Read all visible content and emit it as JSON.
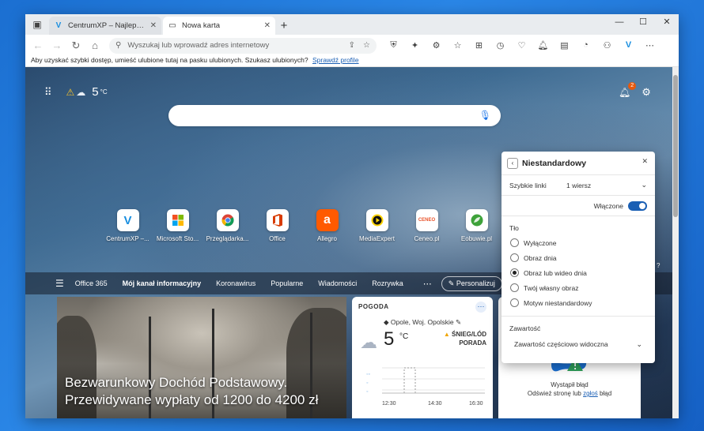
{
  "browser": {
    "tabs": [
      {
        "title": "CentrumXP – Najlepsze źródło o",
        "active": false
      },
      {
        "title": "Nowa karta",
        "active": true
      }
    ],
    "address": {
      "placeholder": "Wyszukaj lub wprowadź adres internetowy"
    },
    "favbar": {
      "text": "Aby uzyskać szybki dostęp, umieść ulubione tutaj na pasku ulubionych. Szukasz ulubionych?",
      "link": "Sprawdź profile"
    }
  },
  "newtab": {
    "weather_temp": "5",
    "weather_unit": "°C",
    "notification_count": "2",
    "tiles": [
      {
        "label": "CentrumXP –...",
        "icon": "centrumxp-logo-icon"
      },
      {
        "label": "Microsoft Sto...",
        "icon": "microsoft-store-icon"
      },
      {
        "label": "Przeglądarka...",
        "icon": "chrome-icon"
      },
      {
        "label": "Office",
        "icon": "office-icon"
      },
      {
        "label": "Allegro",
        "icon": "allegro-icon"
      },
      {
        "label": "MediaExpert",
        "icon": "mediaexpert-icon"
      },
      {
        "label": "Ceneo.pl",
        "icon": "ceneo-icon"
      },
      {
        "label": "Eobuwie.pl",
        "icon": "eobuwie-icon"
      }
    ],
    "nav": [
      "Office 365",
      "Mój kanał informacyjny",
      "Koronawirus",
      "Popularne",
      "Wiadomości",
      "Rozrywka"
    ],
    "personalize": "Personalizuj",
    "headline": [
      "Bezwarunkowy Dochód Podstawowy.",
      "Przewidywane wypłaty od 1200 do 4200 zł"
    ],
    "weather_card": {
      "title": "POGODA",
      "location": "Opole, Woj. Opolskie",
      "temp": "5",
      "unit": "°C",
      "alert_1": "ŚNIEG/LÓD",
      "alert_2": "PORADA",
      "times": [
        "12:30",
        "14:30",
        "16:30"
      ]
    },
    "error_card": {
      "title": "Wystąpił błąd",
      "text_before": "Odśwież stronę lub",
      "link": "zgłoś",
      "text_after": "błąd"
    },
    "side_text": "?"
  },
  "panel": {
    "title": "Niestandardowy",
    "quick_links_label": "Szybkie linki",
    "quick_links_value": "1 wiersz",
    "enabled_label": "Włączone",
    "background_label": "Tło",
    "background_options": [
      "Wyłączone",
      "Obraz dnia",
      "Obraz lub wideo dnia",
      "Twój własny obraz",
      "Motyw niestandardowy"
    ],
    "background_selected": 2,
    "content_label": "Zawartość",
    "content_value": "Zawartość częściowo widoczna"
  },
  "colors": {
    "accent": "#1a5fb4",
    "warning": "#f6c12b",
    "badge": "#e8590c"
  }
}
